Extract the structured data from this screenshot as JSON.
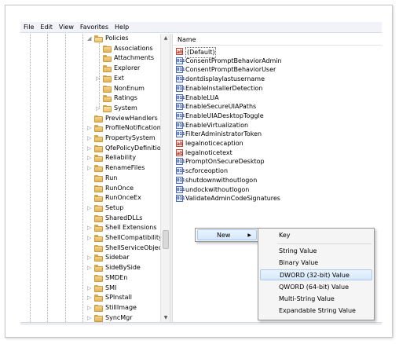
{
  "menubar": {
    "items": [
      "File",
      "Edit",
      "View",
      "Favorites",
      "Help"
    ]
  },
  "tree": {
    "items": [
      {
        "label": "Policies",
        "open": true,
        "expander": "open"
      },
      {
        "label": "Associations",
        "open": false,
        "expander": "none"
      },
      {
        "label": "Attachments",
        "open": false,
        "expander": "none"
      },
      {
        "label": "Explorer",
        "open": false,
        "expander": "none"
      },
      {
        "label": "Ext",
        "open": false,
        "expander": "closed"
      },
      {
        "label": "NonEnum",
        "open": false,
        "expander": "none"
      },
      {
        "label": "Ratings",
        "open": false,
        "expander": "none"
      },
      {
        "label": "System",
        "open": true,
        "expander": "closed"
      },
      {
        "label": "PreviewHandlers",
        "open": false,
        "expander": "none"
      },
      {
        "label": "ProfileNotification",
        "open": false,
        "expander": "closed"
      },
      {
        "label": "PropertySystem",
        "open": false,
        "expander": "closed"
      },
      {
        "label": "QfePolicyDefinitio",
        "open": false,
        "expander": "closed"
      },
      {
        "label": "Reliability",
        "open": false,
        "expander": "closed"
      },
      {
        "label": "RenameFiles",
        "open": false,
        "expander": "closed"
      },
      {
        "label": "Run",
        "open": false,
        "expander": "none"
      },
      {
        "label": "RunOnce",
        "open": false,
        "expander": "none"
      },
      {
        "label": "RunOnceEx",
        "open": false,
        "expander": "none"
      },
      {
        "label": "Setup",
        "open": false,
        "expander": "closed"
      },
      {
        "label": "SharedDLLs",
        "open": false,
        "expander": "none"
      },
      {
        "label": "Shell Extensions",
        "open": false,
        "expander": "closed"
      },
      {
        "label": "ShellCompatibility",
        "open": false,
        "expander": "closed"
      },
      {
        "label": "ShellServiceObject",
        "open": false,
        "expander": "none"
      },
      {
        "label": "Sidebar",
        "open": false,
        "expander": "closed"
      },
      {
        "label": "SideBySide",
        "open": false,
        "expander": "closed"
      },
      {
        "label": "SMDEn",
        "open": false,
        "expander": "none"
      },
      {
        "label": "SMI",
        "open": false,
        "expander": "closed"
      },
      {
        "label": "SPInstall",
        "open": false,
        "expander": "closed"
      },
      {
        "label": "StillImage",
        "open": false,
        "expander": "closed"
      },
      {
        "label": "SyncMgr",
        "open": false,
        "expander": "closed"
      }
    ]
  },
  "values_pane": {
    "column_header": "Name",
    "rows": [
      {
        "name": "(Default)",
        "type": "string"
      },
      {
        "name": "ConsentPromptBehaviorAdmin",
        "type": "binary"
      },
      {
        "name": "ConsentPromptBehaviorUser",
        "type": "binary"
      },
      {
        "name": "dontdisplaylastusername",
        "type": "binary"
      },
      {
        "name": "EnableInstallerDetection",
        "type": "binary"
      },
      {
        "name": "EnableLUA",
        "type": "binary"
      },
      {
        "name": "EnableSecureUIAPaths",
        "type": "binary"
      },
      {
        "name": "EnableUIADesktopToggle",
        "type": "binary"
      },
      {
        "name": "EnableVirtualization",
        "type": "binary"
      },
      {
        "name": "FilterAdministratorToken",
        "type": "binary"
      },
      {
        "name": "legalnoticecaption",
        "type": "string"
      },
      {
        "name": "legalnoticetext",
        "type": "string"
      },
      {
        "name": "PromptOnSecureDesktop",
        "type": "binary"
      },
      {
        "name": "scforceoption",
        "type": "binary"
      },
      {
        "name": "shutdownwithoutlogon",
        "type": "binary"
      },
      {
        "name": "undockwithoutlogon",
        "type": "binary"
      },
      {
        "name": "ValidateAdminCodeSignatures",
        "type": "binary"
      }
    ]
  },
  "context_menu": {
    "new_label": "New",
    "submenu": {
      "items": [
        {
          "label": "Key",
          "highlighted": false
        },
        {
          "label": "String Value",
          "highlighted": false
        },
        {
          "label": "Binary Value",
          "highlighted": false
        },
        {
          "label": "DWORD (32-bit) Value",
          "highlighted": true
        },
        {
          "label": "QWORD (64-bit) Value",
          "highlighted": false
        },
        {
          "label": "Multi-String Value",
          "highlighted": false
        },
        {
          "label": "Expandable String Value",
          "highlighted": false
        }
      ]
    }
  },
  "icons": {
    "string_value": "ab",
    "binary_value": "011"
  },
  "colors": {
    "menu_highlight": "#d6e8fc",
    "folder": "#e3b35a"
  }
}
